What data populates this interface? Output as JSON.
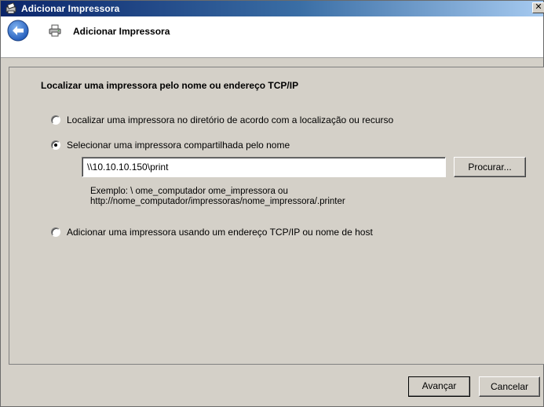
{
  "window": {
    "title": "Adicionar Impressora",
    "close_glyph": "✕"
  },
  "header": {
    "title": "Adicionar Impressora"
  },
  "content": {
    "section_title": "Localizar uma impressora pelo nome ou endereço TCP/IP",
    "options": [
      {
        "label": "Localizar uma impressora no diretório de acordo com a localização ou recurso",
        "selected": false
      },
      {
        "label": "Selecionar uma impressora compartilhada pelo nome",
        "selected": true
      },
      {
        "label": "Adicionar uma impressora usando um endereço TCP/IP ou nome de host",
        "selected": false
      }
    ],
    "path_value": "\\\\10.10.10.150\\print",
    "browse_label": "Procurar...",
    "example_line1": "Exemplo: \\ ome_computador ome_impressora ou",
    "example_line2": "http://nome_computador/impressoras/nome_impressora/.printer"
  },
  "footer": {
    "next_label": "Avançar",
    "cancel_label": "Cancelar"
  },
  "icons": {
    "title": "printer-icon",
    "back": "back-arrow-icon",
    "header": "printer-icon"
  }
}
